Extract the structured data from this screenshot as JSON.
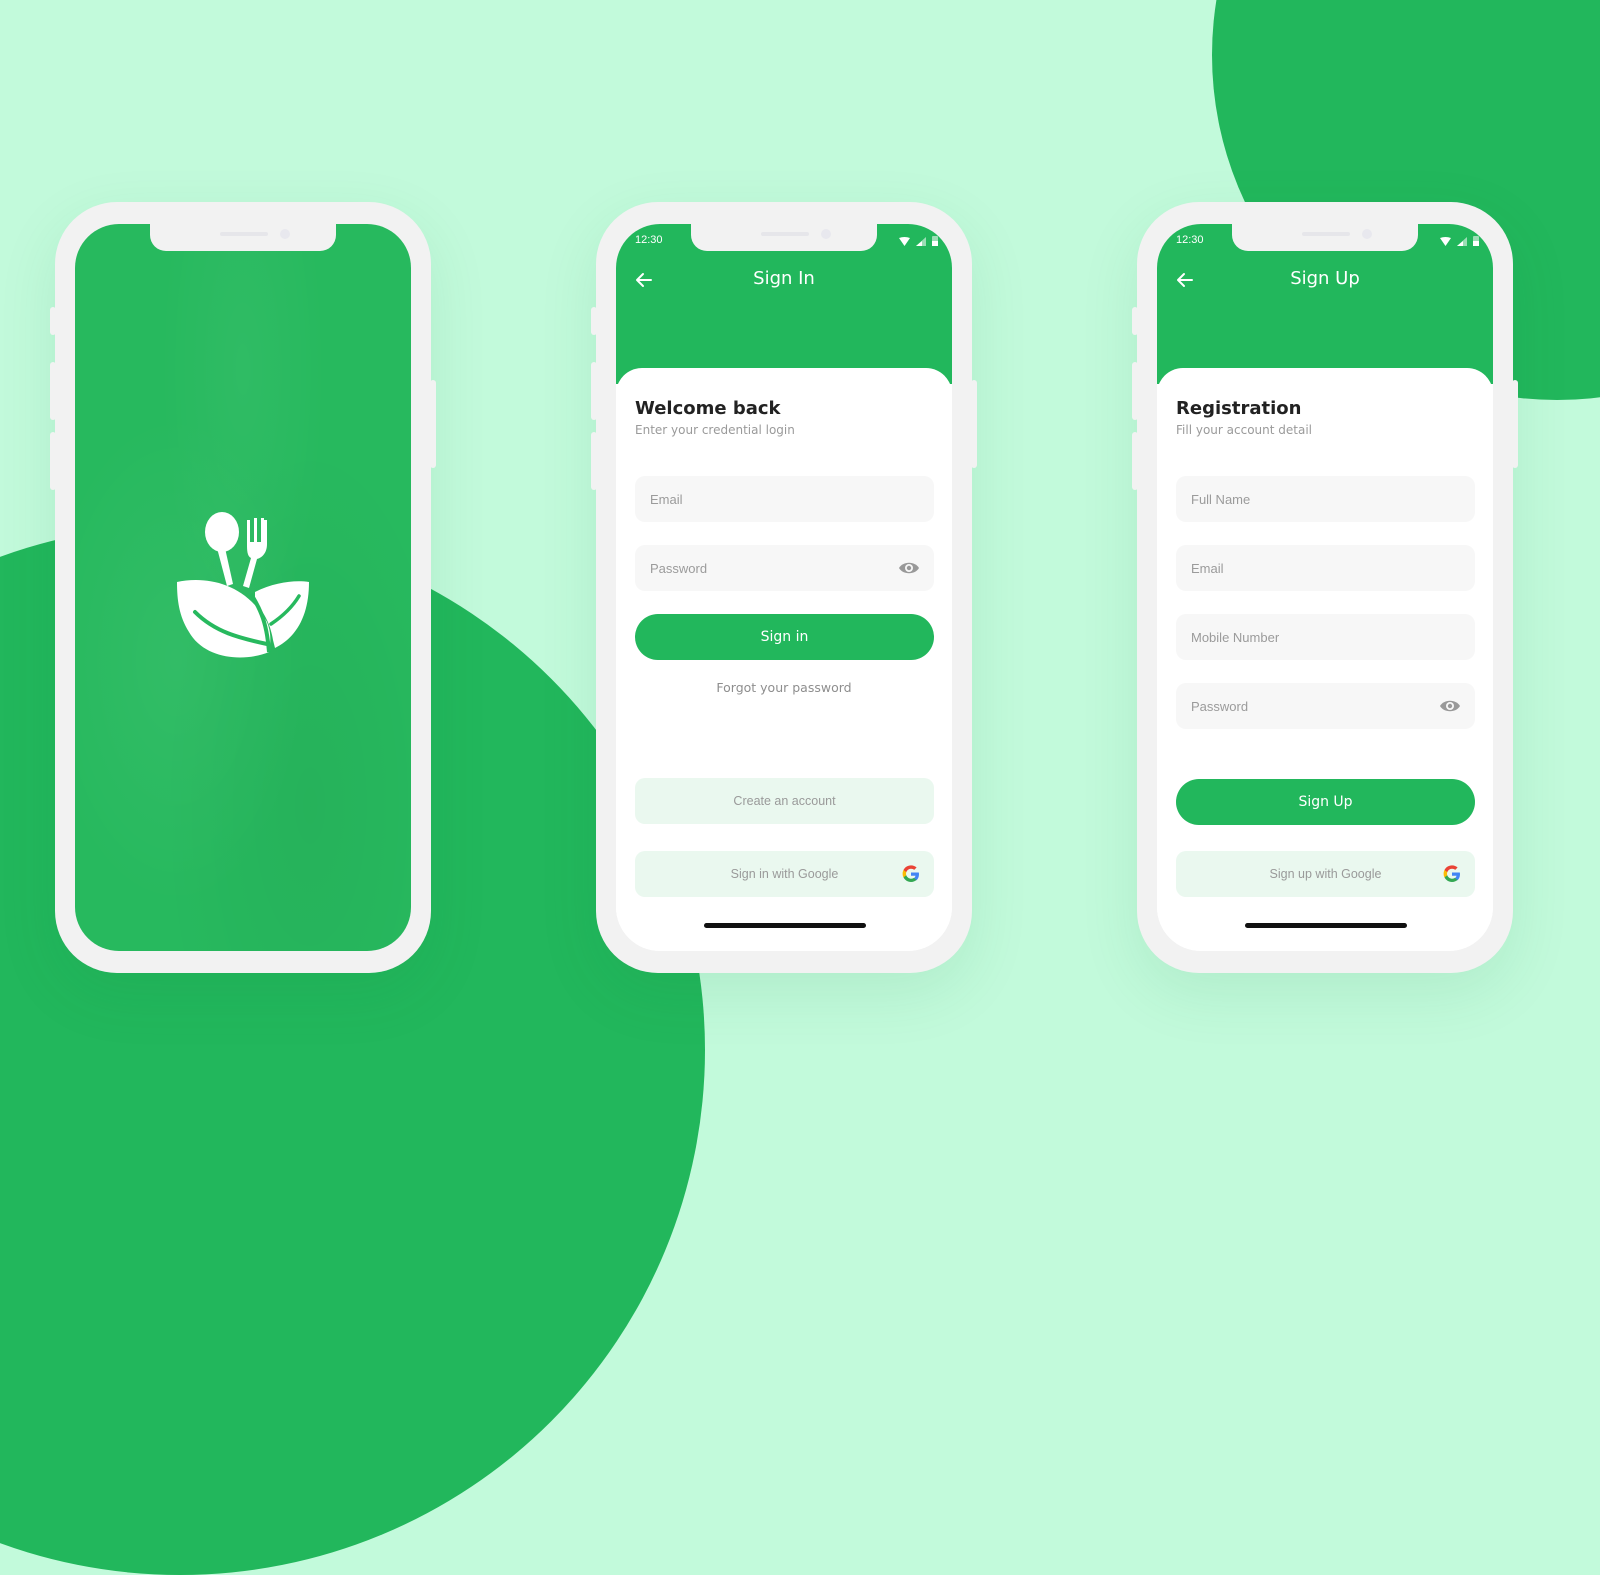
{
  "colors": {
    "background": "#c2fadb",
    "brand_green": "#22b75c",
    "phone_frame": "#f2f2f2",
    "input_bg": "#f7f7f7",
    "soft_button_bg": "#eaf8ef"
  },
  "splash": {
    "logo_icon": "leaf-spoon-fork-logo"
  },
  "signin": {
    "status_time": "12:30",
    "title": "Sign In",
    "heading": "Welcome back",
    "subheading": "Enter your credential login",
    "email_placeholder": "Email",
    "password_placeholder": "Password",
    "signin_button": "Sign in",
    "forgot_link": "Forgot your password",
    "create_account_button": "Create an account",
    "google_button": "Sign in with Google"
  },
  "signup": {
    "status_time": "12:30",
    "title": "Sign Up",
    "heading": "Registration",
    "subheading": "Fill your account detail",
    "fullname_placeholder": "Full Name",
    "email_placeholder": "Email",
    "mobile_placeholder": "Mobile Number",
    "password_placeholder": "Password",
    "signup_button": "Sign Up",
    "google_button": "Sign up with Google"
  }
}
